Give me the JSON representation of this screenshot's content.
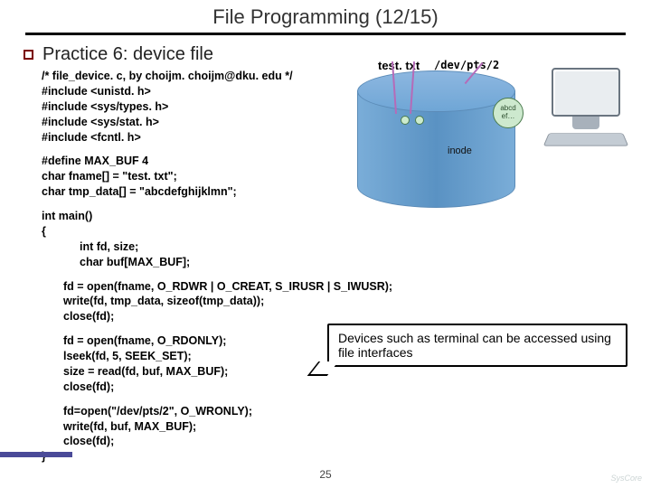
{
  "header": {
    "title": "File Programming (12/15)"
  },
  "section": {
    "title": "Practice 6: device file"
  },
  "labels": {
    "test": "test. txt",
    "dev": "/dev/pts/2",
    "inode": "inode",
    "blob": "abcd\nef…"
  },
  "code": {
    "block1": "/* file_device. c, by choijm. choijm@dku. edu */\n#include <unistd. h>\n#include <sys/types. h>\n#include <sys/stat. h>\n#include <fcntl. h>",
    "block2": "#define MAX_BUF 4\nchar fname[] = \"test. txt\";\nchar tmp_data[] = \"abcdefghijklmn\";",
    "main_open": "int main()\n{",
    "decl": "int fd, size;\nchar buf[MAX_BUF];",
    "block3": "fd = open(fname, O_RDWR | O_CREAT, S_IRUSR | S_IWUSR);\nwrite(fd, tmp_data, sizeof(tmp_data));\nclose(fd);",
    "block4": "fd = open(fname, O_RDONLY);\nlseek(fd, 5, SEEK_SET);\nsize = read(fd, buf, MAX_BUF);\nclose(fd);",
    "block5": "fd=open(\"/dev/pts/2\", O_WRONLY);\nwrite(fd, buf, MAX_BUF);\nclose(fd);",
    "main_close": "}"
  },
  "callout": {
    "text": "Devices such as terminal can be accessed using file interfaces"
  },
  "page": {
    "num": "25"
  },
  "logo": {
    "text": "SysCore"
  }
}
